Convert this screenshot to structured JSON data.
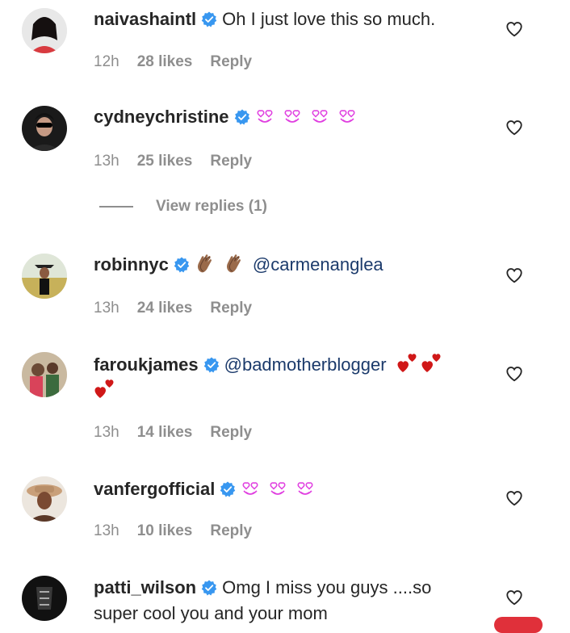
{
  "comments": [
    {
      "username": "naivashaintl",
      "text": "Oh I just love this so much.",
      "time": "12h",
      "likes": "28 likes",
      "reply": "Reply"
    },
    {
      "username": "cydneychristine",
      "emoji": "heart-eyes-emoji x4",
      "time": "13h",
      "likes": "25 likes",
      "reply": "Reply",
      "view_replies": "View replies (1)"
    },
    {
      "username": "robinnyc",
      "emoji": "clapping-hands-emoji x2",
      "mention": "@carmenanglea",
      "time": "13h",
      "likes": "24 likes",
      "reply": "Reply"
    },
    {
      "username": "faroukjames",
      "mention": "@badmotherblogger",
      "emoji": "heart-exclamation-emoji x3",
      "time": "13h",
      "likes": "14 likes",
      "reply": "Reply"
    },
    {
      "username": "vanfergofficial",
      "emoji": "heart-eyes-emoji x3",
      "time": "13h",
      "likes": "10 likes",
      "reply": "Reply"
    },
    {
      "username": "patti_wilson",
      "text_line1": "Omg I miss you guys ....so",
      "text_line2": "super cool you and your mom"
    }
  ],
  "icons": {
    "verified": "verified-badge-icon",
    "like": "heart-outline-icon"
  },
  "colors": {
    "verified": "#3897f0",
    "meta": "#8e8e8e",
    "mention": "#1b3a6b",
    "heart_eyes": "#e040e0",
    "red_heart": "#d01818"
  }
}
